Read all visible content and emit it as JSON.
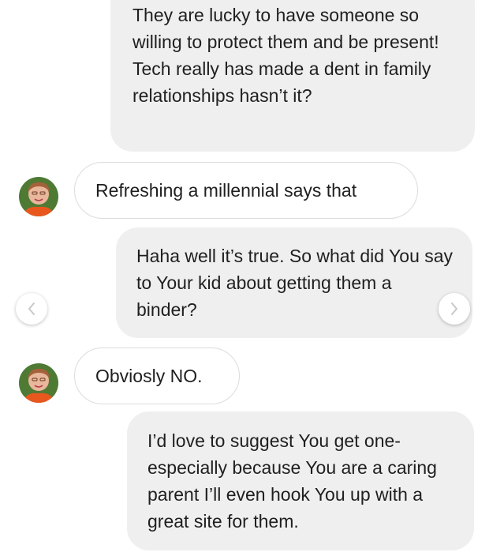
{
  "messages": [
    {
      "from": "me",
      "text": "They are lucky to have someone so willing to protect them and be present! Tech really has made a dent in family relationships hasn’t it?"
    },
    {
      "from": "them",
      "text": "Refreshing a millennial says that"
    },
    {
      "from": "me",
      "text": "Haha well it’s true. So what did You say to Your kid about getting them a binder?"
    },
    {
      "from": "them",
      "text": "Obviosly NO."
    },
    {
      "from": "me",
      "text": "I’d love to suggest You get one-especially because You are a caring parent I’ll even hook You up with a great site for them."
    }
  ],
  "icons": {
    "prev": "chevron-left-icon",
    "next": "chevron-right-icon",
    "avatar": "contact-avatar"
  },
  "colors": {
    "sent_bubble": "#efefef",
    "received_border": "#dcdcdc",
    "text": "#1f1f1f"
  }
}
